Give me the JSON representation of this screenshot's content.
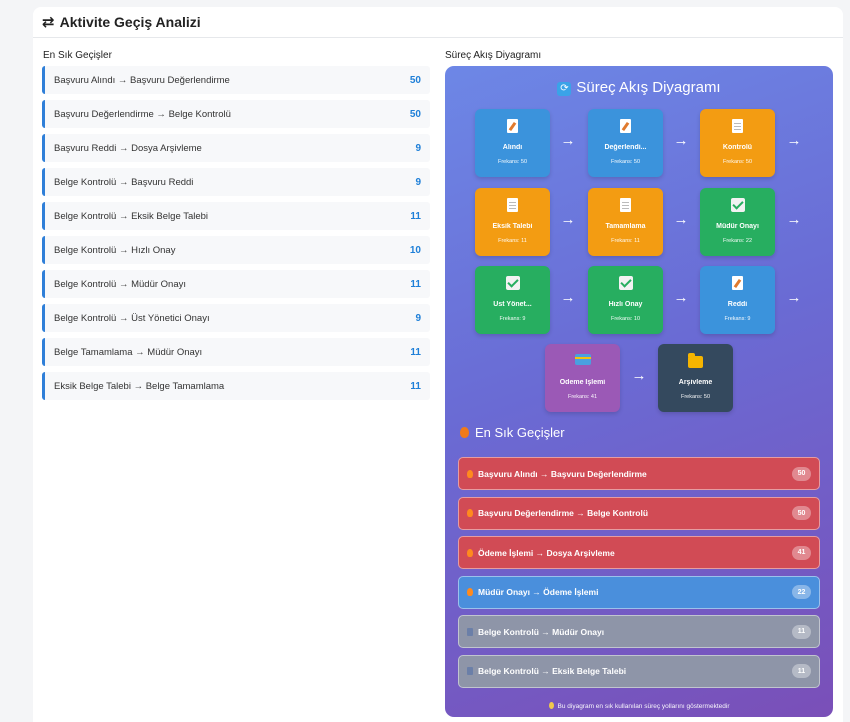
{
  "header": {
    "title": "Aktivite Geçiş Analizi",
    "icon": "swap-arrows-icon"
  },
  "left": {
    "label": "En Sık Geçişler",
    "items": [
      {
        "name": "Başvuru Alındı → Başvuru Değerlendirme",
        "count": "50"
      },
      {
        "name": "Başvuru Değerlendirme → Belge Kontrolü",
        "count": "50"
      },
      {
        "name": "Başvuru Reddi → Dosya Arşivleme",
        "count": "9"
      },
      {
        "name": "Belge Kontrolü → Başvuru Reddi",
        "count": "9"
      },
      {
        "name": "Belge Kontrolü → Eksik Belge Talebi",
        "count": "11"
      },
      {
        "name": "Belge Kontrolü → Hızlı Onay",
        "count": "10"
      },
      {
        "name": "Belge Kontrolü → Müdür Onayı",
        "count": "11"
      },
      {
        "name": "Belge Kontrolü → Üst Yönetici Onayı",
        "count": "9"
      },
      {
        "name": "Belge Tamamlama → Müdür Onayı",
        "count": "11"
      },
      {
        "name": "Eksik Belge Talebi → Belge Tamamlama",
        "count": "11"
      }
    ]
  },
  "right": {
    "label": "Süreç Akış Diyagramı",
    "title": "Süreç Akış Diyagramı",
    "arrow": "→",
    "nodes": [
      {
        "name": "Alındı",
        "freq": "Frekans: 50",
        "color": "#3b93dc",
        "icon": "document-edit-icon"
      },
      {
        "name": "Değerlendi...",
        "freq": "Frekans: 50",
        "color": "#3b93dc",
        "icon": "document-edit-icon"
      },
      {
        "name": "Kontrolü",
        "freq": "Frekans: 50",
        "color": "#f39c12",
        "icon": "document-icon"
      },
      {
        "name": "Eksik Talebi",
        "freq": "Frekans: 11",
        "color": "#f39c12",
        "icon": "document-icon"
      },
      {
        "name": "Tamamlama",
        "freq": "Frekans: 11",
        "color": "#f39c12",
        "icon": "document-icon"
      },
      {
        "name": "Müdür Onayı",
        "freq": "Frekans: 22",
        "color": "#27ae60",
        "icon": "check-icon"
      },
      {
        "name": "Üst Yönet...",
        "freq": "Frekans: 9",
        "color": "#27ae60",
        "icon": "check-icon"
      },
      {
        "name": "Hızlı Onay",
        "freq": "Frekans: 10",
        "color": "#27ae60",
        "icon": "check-icon"
      },
      {
        "name": "Reddi",
        "freq": "Frekans: 9",
        "color": "#3b93dc",
        "icon": "document-edit-icon"
      },
      {
        "name": "Ödeme İşlemi",
        "freq": "Frekans: 41",
        "color": "#9b59b6",
        "icon": "credit-card-icon"
      },
      {
        "name": "Arşivleme",
        "freq": "Frekans: 50",
        "color": "#34495e",
        "icon": "folder-icon"
      }
    ],
    "top_title": "En Sık Geçişler",
    "top_items": [
      {
        "name": "Başvuru Alındı → Başvuru Değerlendirme",
        "count": "50",
        "style": "red",
        "icon": "fire-icon"
      },
      {
        "name": "Başvuru Değerlendirme → Belge Kontrolü",
        "count": "50",
        "style": "red",
        "icon": "fire-icon"
      },
      {
        "name": "Ödeme İşlemi → Dosya Arşivleme",
        "count": "41",
        "style": "red",
        "icon": "fire-icon"
      },
      {
        "name": "Müdür Onayı → Ödeme İşlemi",
        "count": "22",
        "style": "blue",
        "icon": "fire-icon"
      },
      {
        "name": "Belge Kontrolü → Müdür Onayı",
        "count": "11",
        "style": "gray",
        "icon": "bar-chart-icon"
      },
      {
        "name": "Belge Kontrolü → Eksik Belge Talebi",
        "count": "11",
        "style": "gray",
        "icon": "bar-chart-icon"
      }
    ],
    "footnote": "Bu diyagram en sık kullanılan süreç yollarını göstermektedir"
  }
}
